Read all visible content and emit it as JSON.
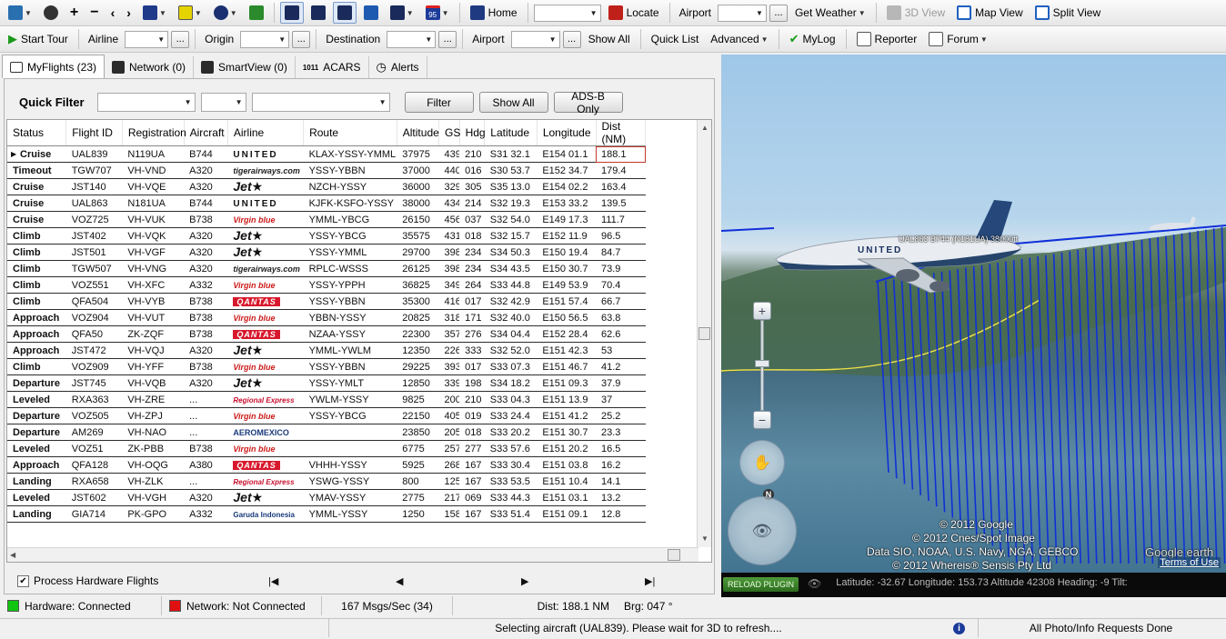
{
  "toolbar1": {
    "home": "Home",
    "locate": "Locate",
    "airport": "Airport",
    "ellipsis": "...",
    "get_weather": "Get Weather",
    "view_3d": "3D View",
    "map_view": "Map View",
    "split_view": "Split View",
    "badge_95": "95"
  },
  "toolbar2": {
    "start_tour": "Start Tour",
    "airline": "Airline",
    "origin": "Origin",
    "destination": "Destination",
    "airport": "Airport",
    "show_all": "Show All",
    "quick_list": "Quick List",
    "advanced": "Advanced",
    "mylog": "MyLog",
    "reporter": "Reporter",
    "forum": "Forum",
    "ellipsis": "..."
  },
  "tabs": [
    {
      "label": "MyFlights (23)"
    },
    {
      "label": "Network (0)"
    },
    {
      "label": "SmartView (0)"
    },
    {
      "label": "ACARS"
    },
    {
      "label": "Alerts"
    }
  ],
  "quick_filter": {
    "label": "Quick Filter",
    "filter_button": "Filter",
    "show_all_button": "Show All",
    "adsb_button": "ADS-B Only"
  },
  "columns": [
    "Status",
    "Flight ID",
    "Registration",
    "Aircraft",
    "Airline",
    "Route",
    "Altitude",
    "GS",
    "Hdg",
    "Latitude",
    "Longitude",
    "Dist (NM)"
  ],
  "flights": [
    {
      "status": "Cruise",
      "cls": "cruise",
      "flight": "UAL839",
      "reg": "N119UA",
      "ac": "B744",
      "airline": "UNITED",
      "logo": "united",
      "route": "KLAX-YSSY-YMML",
      "alt": "37975",
      "gs": "439",
      "hdg": "210",
      "lat": "S31 32.1",
      "lon": "E154 01.1",
      "dist": "188.1"
    },
    {
      "status": "Timeout",
      "cls": "timeout",
      "flight": "TGW707",
      "reg": "VH-VND",
      "ac": "A320",
      "airline": "tigerairways.com",
      "logo": "tiger",
      "route": "YSSY-YBBN",
      "alt": "37000",
      "gs": "440",
      "hdg": "016",
      "lat": "S30 53.7",
      "lon": "E152 34.7",
      "dist": "179.4"
    },
    {
      "status": "Cruise",
      "cls": "cruise",
      "flight": "JST140",
      "reg": "VH-VQE",
      "ac": "A320",
      "airline": "Jet★",
      "logo": "jetstar",
      "route": "NZCH-YSSY",
      "alt": "36000",
      "gs": "329",
      "hdg": "305",
      "lat": "S35 13.0",
      "lon": "E154 02.2",
      "dist": "163.4"
    },
    {
      "status": "Cruise",
      "cls": "cruise",
      "flight": "UAL863",
      "reg": "N181UA",
      "ac": "B744",
      "airline": "UNITED",
      "logo": "united",
      "route": "KJFK-KSFO-YSSY",
      "alt": "38000",
      "gs": "434",
      "hdg": "214",
      "lat": "S32 19.3",
      "lon": "E153 33.2",
      "dist": "139.5"
    },
    {
      "status": "Cruise",
      "cls": "cruise",
      "flight": "VOZ725",
      "reg": "VH-VUK",
      "ac": "B738",
      "airline": "Virgin blue",
      "logo": "virgin",
      "route": "YMML-YBCG",
      "alt": "26150",
      "gs": "456",
      "hdg": "037",
      "lat": "S32 54.0",
      "lon": "E149 17.3",
      "dist": "111.7"
    },
    {
      "status": "Climb",
      "cls": "climb",
      "flight": "JST402",
      "reg": "VH-VQK",
      "ac": "A320",
      "airline": "Jet★",
      "logo": "jetstar",
      "route": "YSSY-YBCG",
      "alt": "35575",
      "gs": "431",
      "hdg": "018",
      "lat": "S32 15.7",
      "lon": "E152 11.9",
      "dist": "96.5"
    },
    {
      "status": "Climb",
      "cls": "climb",
      "flight": "JST501",
      "reg": "VH-VGF",
      "ac": "A320",
      "airline": "Jet★",
      "logo": "jetstar",
      "route": "YSSY-YMML",
      "alt": "29700",
      "gs": "398",
      "hdg": "234",
      "lat": "S34 50.3",
      "lon": "E150 19.4",
      "dist": "84.7"
    },
    {
      "status": "Climb",
      "cls": "climb",
      "flight": "TGW507",
      "reg": "VH-VNG",
      "ac": "A320",
      "airline": "tigerairways.com",
      "logo": "tiger",
      "route": "RPLC-WSSS",
      "alt": "26125",
      "gs": "398",
      "hdg": "234",
      "lat": "S34 43.5",
      "lon": "E150 30.7",
      "dist": "73.9"
    },
    {
      "status": "Climb",
      "cls": "climb",
      "flight": "VOZ551",
      "reg": "VH-XFC",
      "ac": "A332",
      "airline": "Virgin blue",
      "logo": "virgin",
      "route": "YSSY-YPPH",
      "alt": "36825",
      "gs": "349",
      "hdg": "264",
      "lat": "S33 44.8",
      "lon": "E149 53.9",
      "dist": "70.4"
    },
    {
      "status": "Climb",
      "cls": "climb",
      "flight": "QFA504",
      "reg": "VH-VYB",
      "ac": "B738",
      "airline": "QANTAS",
      "logo": "qantas",
      "route": "YSSY-YBBN",
      "alt": "35300",
      "gs": "416",
      "hdg": "017",
      "lat": "S32 42.9",
      "lon": "E151 57.4",
      "dist": "66.7"
    },
    {
      "status": "Approach",
      "cls": "approach",
      "flight": "VOZ904",
      "reg": "VH-VUT",
      "ac": "B738",
      "airline": "Virgin blue",
      "logo": "virgin",
      "route": "YBBN-YSSY",
      "alt": "20825",
      "gs": "318",
      "hdg": "171",
      "lat": "S32 40.0",
      "lon": "E150 56.5",
      "dist": "63.8"
    },
    {
      "status": "Approach",
      "cls": "approach",
      "flight": "QFA50",
      "reg": "ZK-ZQF",
      "ac": "B738",
      "airline": "QANTAS",
      "logo": "qantas",
      "route": "NZAA-YSSY",
      "alt": "22300",
      "gs": "357",
      "hdg": "276",
      "lat": "S34 04.4",
      "lon": "E152 28.4",
      "dist": "62.6"
    },
    {
      "status": "Approach",
      "cls": "approach",
      "flight": "JST472",
      "reg": "VH-VQJ",
      "ac": "A320",
      "airline": "Jet★",
      "logo": "jetstar",
      "route": "YMML-YWLM",
      "alt": "12350",
      "gs": "226",
      "hdg": "333",
      "lat": "S32 52.0",
      "lon": "E151 42.3",
      "dist": "53"
    },
    {
      "status": "Climb",
      "cls": "climb",
      "flight": "VOZ909",
      "reg": "VH-YFF",
      "ac": "B738",
      "airline": "Virgin blue",
      "logo": "virgin",
      "route": "YSSY-YBBN",
      "alt": "29225",
      "gs": "393",
      "hdg": "017",
      "lat": "S33 07.3",
      "lon": "E151 46.7",
      "dist": "41.2"
    },
    {
      "status": "Departure",
      "cls": "departure",
      "flight": "JST745",
      "reg": "VH-VQB",
      "ac": "A320",
      "airline": "Jet★",
      "logo": "jetstar",
      "route": "YSSY-YMLT",
      "alt": "12850",
      "gs": "339",
      "hdg": "198",
      "lat": "S34 18.2",
      "lon": "E151 09.3",
      "dist": "37.9"
    },
    {
      "status": "Leveled",
      "cls": "leveled",
      "flight": "RXA363",
      "reg": "VH-ZRE",
      "ac": "...",
      "airline": "Regional Express",
      "logo": "rex",
      "route": "YWLM-YSSY",
      "alt": "9825",
      "gs": "200",
      "hdg": "210",
      "lat": "S33 04.3",
      "lon": "E151 13.9",
      "dist": "37"
    },
    {
      "status": "Departure",
      "cls": "departure",
      "flight": "VOZ505",
      "reg": "VH-ZPJ",
      "ac": "...",
      "airline": "Virgin blue",
      "logo": "virgin",
      "route": "YSSY-YBCG",
      "alt": "22150",
      "gs": "405",
      "hdg": "019",
      "lat": "S33 24.4",
      "lon": "E151 41.2",
      "dist": "25.2"
    },
    {
      "status": "Departure",
      "cls": "departure",
      "flight": "AM269",
      "reg": "VH-NAO",
      "ac": "...",
      "airline": "AEROMEXICO",
      "logo": "aeromexico",
      "route": "",
      "alt": "23850",
      "gs": "205",
      "hdg": "018",
      "lat": "S33 20.2",
      "lon": "E151 30.7",
      "dist": "23.3"
    },
    {
      "status": "Leveled",
      "cls": "leveled",
      "flight": "VOZ51",
      "reg": "ZK-PBB",
      "ac": "B738",
      "airline": "Virgin blue",
      "logo": "virgin",
      "route": "",
      "alt": "6775",
      "gs": "257",
      "hdg": "277",
      "lat": "S33 57.6",
      "lon": "E151 20.2",
      "dist": "16.5"
    },
    {
      "status": "Approach",
      "cls": "approach",
      "flight": "QFA128",
      "reg": "VH-OQG",
      "ac": "A380",
      "airline": "QANTAS",
      "logo": "qantas",
      "route": "VHHH-YSSY",
      "alt": "5925",
      "gs": "268",
      "hdg": "167",
      "lat": "S33 30.4",
      "lon": "E151 03.8",
      "dist": "16.2"
    },
    {
      "status": "Landing",
      "cls": "landing",
      "flight": "RXA658",
      "reg": "VH-ZLK",
      "ac": "...",
      "airline": "Regional Express",
      "logo": "rex",
      "route": "YSWG-YSSY",
      "alt": "800",
      "gs": "125",
      "hdg": "167",
      "lat": "S33 53.5",
      "lon": "E151 10.4",
      "dist": "14.1"
    },
    {
      "status": "Leveled",
      "cls": "leveled",
      "flight": "JST602",
      "reg": "VH-VGH",
      "ac": "A320",
      "airline": "Jet★",
      "logo": "jetstar",
      "route": "YMAV-YSSY",
      "alt": "2775",
      "gs": "217",
      "hdg": "069",
      "lat": "S33 44.3",
      "lon": "E151 03.1",
      "dist": "13.2"
    },
    {
      "status": "Landing",
      "cls": "landing",
      "flight": "GIA714",
      "reg": "PK-GPO",
      "ac": "A332",
      "airline": "Garuda Indonesia",
      "logo": "garuda",
      "route": "YMML-YSSY",
      "alt": "1250",
      "gs": "158",
      "hdg": "167",
      "lat": "S33 51.4",
      "lon": "E151 09.1",
      "dist": "12.8"
    }
  ],
  "bottom": {
    "process_hw": "Process Hardware Flights",
    "first": "|◀",
    "prev": "◀",
    "next": "▶",
    "last": "▶|"
  },
  "status": {
    "hardware": "Hardware: Connected",
    "network": "Network: Not Connected",
    "msgs": "167 Msgs/Sec (34)",
    "dist": "Dist:  188.1 NM",
    "brg": "Brg: 047 °",
    "message": "Selecting aircraft (UAL839). Please wait for 3D to refresh....",
    "requests": "All Photo/Info Requests Done",
    "hw_color": "#11c511",
    "net_color": "#e01010"
  },
  "view3d": {
    "aircraft_label": "UAL863 B744 (N181UA) 38000ft",
    "copyright1": "© 2012 Google",
    "copyright2": "© 2012 Cnes/Spot Image",
    "copyright3": "Data SIO, NOAA, U.S. Navy, NGA, GEBCO",
    "copyright4": "© 2012 Whereis® Sensis Pty Ltd",
    "google_earth": "Google earth",
    "terms": "Terms of Use",
    "reload": "RELOAD PLUGIN",
    "coords": "Latitude: -32.67  Longitude: 153.73  Altitude 42308  Heading: -9  Tilt:",
    "compass_n": "N",
    "zoom_in": "+",
    "zoom_out": "−"
  }
}
